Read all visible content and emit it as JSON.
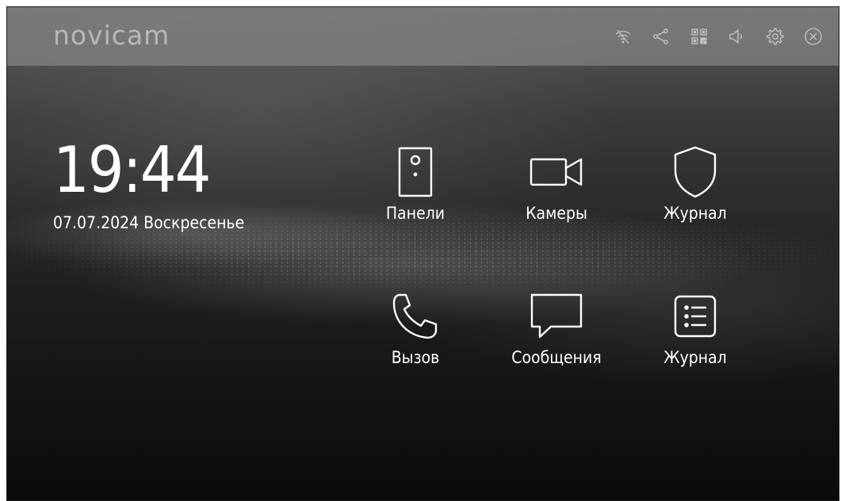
{
  "header": {
    "logo": "novicam",
    "icons": [
      "wifi-off-icon",
      "share-icon",
      "qr-code-icon",
      "volume-icon",
      "settings-icon",
      "close-icon"
    ]
  },
  "status": {
    "time": "19:44",
    "date": "07.07.2024 Воскресенье"
  },
  "menu": {
    "panels": "Панели",
    "cameras": "Камеры",
    "journal_events": "Журнал",
    "call": "Вызов",
    "messages": "Сообщения",
    "journal_list": "Журнал"
  },
  "colors": {
    "text": "#ffffff",
    "topbar": "#8c8c8c"
  }
}
